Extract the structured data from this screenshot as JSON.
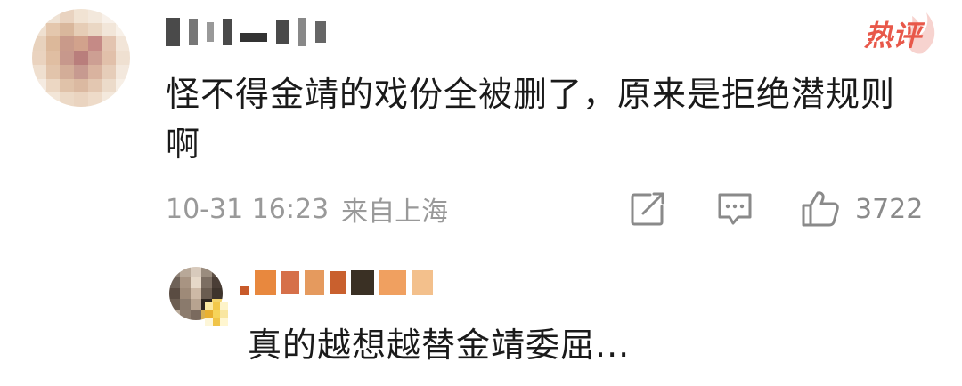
{
  "comment": {
    "text": "怪不得金靖的戏份全被删了，原来是拒绝潜规则啊",
    "timestamp": "10-31 16:23",
    "location": "来自上海",
    "hot_badge": "热评",
    "like_count": "3722"
  },
  "reply": {
    "text": "真的越想越替金靖委屈..."
  },
  "icons": {
    "repost": "share-icon",
    "comment": "comment-icon",
    "like": "thumbs-up-icon"
  },
  "colors": {
    "text": "#1a1a1a",
    "meta": "#999999",
    "hot_badge": "#e8584a"
  }
}
